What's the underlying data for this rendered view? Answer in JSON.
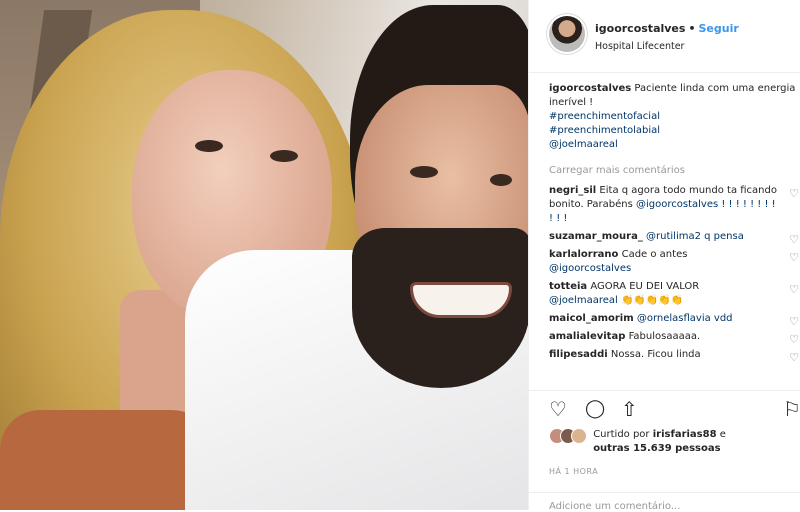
{
  "post": {
    "username": "igoorcostalves",
    "dot": "•",
    "follow_label": "Seguir",
    "location": "Hospital Lifecenter",
    "caption": {
      "user": "igoorcostalves",
      "text": "Paciente linda com uma energia inerível !",
      "tags": [
        "#preenchimentofacial",
        "#preenchimentolabial",
        "@joelmaareal"
      ]
    },
    "load_more": "Carregar mais comentários",
    "comments": [
      {
        "user": "negri_sil",
        "text": "Eita q agora todo mundo ta ficando bonito. Parabéns",
        "mention": "@igoorcostalves ! ! ! ! ! ! ! ! ! ! !"
      },
      {
        "user": "suzamar_moura_",
        "text": "",
        "mention": "@rutilima2 q pensa"
      },
      {
        "user": "karlalorrano",
        "text": "Cade o antes",
        "mention": "@igoorcostalves"
      },
      {
        "user": "totteia",
        "text": "AGORA EU DEI VALOR",
        "mention": "@joelmaareal 👏👏👏👏👏"
      },
      {
        "user": "maicol_amorim",
        "text": "",
        "mention": "@ornelasflavia vdd"
      },
      {
        "user": "amalialevitap",
        "text": "Fabulosaaaaa.",
        "mention": ""
      },
      {
        "user": "filipesaddi",
        "text": "Nossa. Ficou linda",
        "mention": ""
      }
    ],
    "likes": {
      "prefix": "Curtido por",
      "user": "irisfarias88",
      "joiner": "e",
      "others": "outras 15.639 pessoas"
    },
    "time": "HÁ 1 HORA",
    "add_comment_placeholder": "Adicione um comentário..."
  },
  "icons": {
    "heart": "♡",
    "comment": "◯",
    "share": "⇧",
    "bookmark": "⚐"
  },
  "colors": {
    "link": "#3897f0",
    "mention": "#003569",
    "muted": "#999999"
  }
}
